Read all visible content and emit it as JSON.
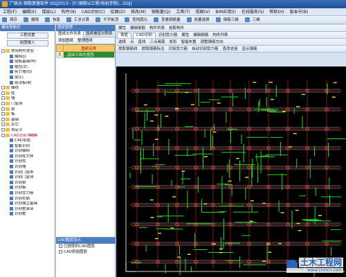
{
  "window": {
    "title": "广联达-钢筋算量软件 GGJ2013 - [F:\\钢筋\\0工程\\电机学院\\...GGJ]"
  },
  "menu": [
    "工程(F)",
    "编辑(E)",
    "楼层(L)",
    "构件(N)",
    "CAD识别(C)",
    "绘图(D)",
    "修改(M)",
    "钢筋量(Q)",
    "工具(T)",
    "视图(V)",
    "BIM应用(I)",
    "在线服务(S)",
    "帮助(H)",
    "版本号(B)"
  ],
  "toolbar1": [
    "保存",
    "撤销",
    "恢复",
    "汇总计算",
    "平齐板顶",
    "查找图元",
    "查看钢筋量",
    "批量选择",
    "钢筋三维",
    "三维"
  ],
  "nav": {
    "header": "模块导航栏",
    "btn_settings": "工程设置",
    "btn_input": "绘图输入",
    "tree": [
      {
        "label": "常用构件类型",
        "type": "fold",
        "red": false
      },
      {
        "label": "轴网(J)",
        "type": "leaf",
        "red": false
      },
      {
        "label": "筏板基础(M)",
        "type": "leaf",
        "red": false
      },
      {
        "label": "框柱(Z)",
        "type": "leaf",
        "red": false
      },
      {
        "label": "剪力墙(Q)",
        "type": "leaf",
        "red": false
      },
      {
        "label": "梁(L)",
        "type": "leaf",
        "red": false
      },
      {
        "label": "现浇板(B)",
        "type": "leaf",
        "red": false
      },
      {
        "label": "轴线",
        "type": "fold",
        "red": false
      },
      {
        "label": "柱",
        "type": "fold",
        "red": false
      },
      {
        "label": "墙",
        "type": "fold",
        "red": false
      },
      {
        "label": "门窗洞",
        "type": "fold",
        "red": false
      },
      {
        "label": "梁",
        "type": "fold",
        "red": false
      },
      {
        "label": "板",
        "type": "fold",
        "red": false
      },
      {
        "label": "基础",
        "type": "fold",
        "red": false
      },
      {
        "label": "其它",
        "type": "fold",
        "red": false
      },
      {
        "label": "自定义",
        "type": "fold",
        "red": false
      },
      {
        "label": "CAD识别",
        "type": "fold",
        "red": true
      },
      {
        "label": "CAD草图",
        "type": "leaf",
        "red": false
      },
      {
        "label": "智能识别",
        "type": "leaf",
        "red": false
      },
      {
        "label": "识别轴网",
        "type": "leaf",
        "red": false
      },
      {
        "label": "识别柱大样",
        "type": "leaf",
        "red": false
      },
      {
        "label": "识别柱",
        "type": "leaf",
        "red": false
      },
      {
        "label": "识别墙",
        "type": "leaf",
        "red": false
      },
      {
        "label": "识别门窗表",
        "type": "leaf",
        "red": false
      },
      {
        "label": "识别门窗洞",
        "type": "leaf",
        "red": false
      },
      {
        "label": "识别梁",
        "type": "leaf",
        "red": false
      },
      {
        "label": "识别板",
        "type": "leaf",
        "red": false
      },
      {
        "label": "识别受力筋",
        "type": "leaf",
        "red": false
      },
      {
        "label": "识别负筋",
        "type": "leaf",
        "red": false
      },
      {
        "label": "识别独立基础",
        "type": "leaf",
        "red": false
      },
      {
        "label": "识别桩承台",
        "type": "leaf",
        "red": false
      },
      {
        "label": "识别桩",
        "type": "leaf",
        "red": false
      }
    ],
    "new_badge": "NEW"
  },
  "drawings": {
    "header": "图纸管理",
    "tabs": [
      "图纸文件列表",
      "图纸楼层对照表"
    ],
    "buttons": [
      "添加图纸",
      "整理图纸"
    ],
    "col_name": "图纸名称",
    "rows": [
      {
        "num": "1",
        "name": "...基础平面布置图"
      }
    ]
  },
  "layers": {
    "header": "CAD图层显示",
    "rows": [
      {
        "label": "已提取的CAD图层"
      },
      {
        "label": "CAD原始图层"
      }
    ]
  },
  "editor_tb1": [
    "属性",
    "编辑钢筋",
    "构件列表",
    "拾取构件"
  ],
  "editor_tb2": [
    "首层",
    "CAD识别",
    "识别受力筋",
    "属性",
    "编辑钢筋",
    "构件列表"
  ],
  "editor_tb3": [
    "选择",
    "点",
    "直线",
    "三点画弧",
    "矩形",
    "智能布置",
    "调整钢筋方向"
  ],
  "editor_tb4": [
    "提取钢筋线",
    "提取钢筋标注",
    "识别受力筋",
    "自动识别受力筋",
    "查改支座",
    "显示钢筋"
  ],
  "watermark": {
    "title": "土木工程网",
    "url": "www.civilcn.com"
  },
  "colors": {
    "canvas_bg": "#000000",
    "grid": "#ff3030",
    "rebar": "#22dd22",
    "text": "#e8e040"
  }
}
